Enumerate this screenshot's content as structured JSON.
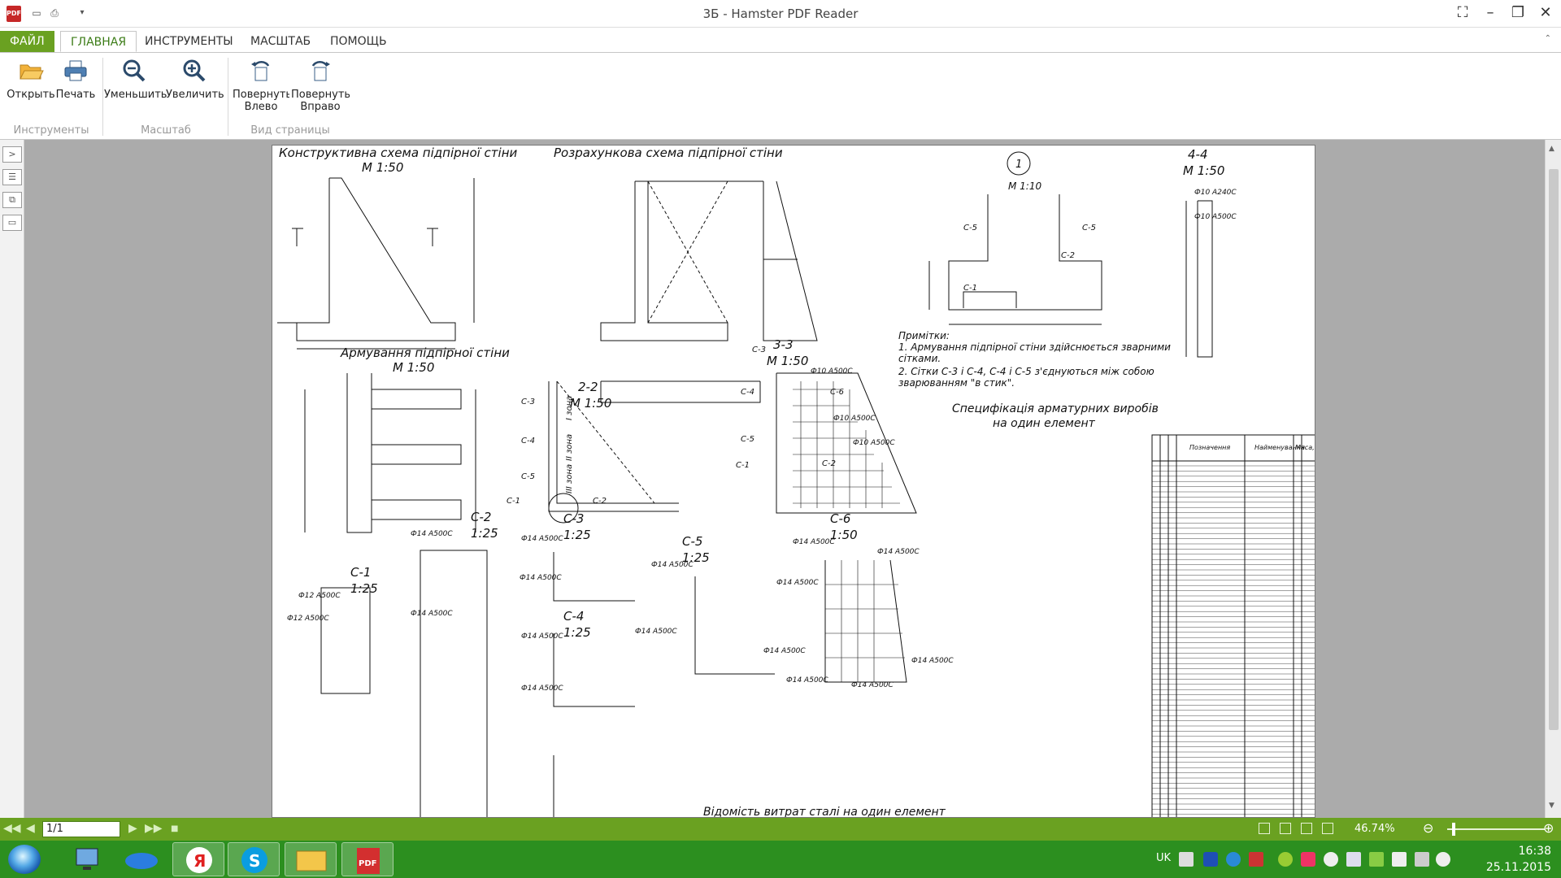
{
  "window": {
    "title": "3Б - Hamster PDF Reader",
    "app_icon_label": "PDF"
  },
  "quick_access": {
    "open_icon": "folder-open-icon",
    "print_icon": "printer-icon",
    "customize_icon": "dropdown-icon"
  },
  "tabs": [
    {
      "label": "ФАЙЛ"
    },
    {
      "label": "ГЛАВНАЯ"
    },
    {
      "label": "ИНСТРУМЕНТЫ"
    },
    {
      "label": "МАСШТАБ"
    },
    {
      "label": "ПОМОЩЬ"
    }
  ],
  "ribbon": {
    "open": "Открыть",
    "print": "Печать",
    "zoom_out": "Уменьшить",
    "zoom_in": "Увеличить",
    "rotate_left": "Повернуть Влево",
    "rotate_right": "Повернуть Вправо",
    "group_tools": "Инструменты",
    "group_scale": "Масштаб",
    "group_page_view": "Вид страницы"
  },
  "status": {
    "page": "1/1",
    "zoom": "46.74%"
  },
  "drawing": {
    "title_construct": "Конструктивна схема підпірної стіни",
    "title_calc": "Розрахункова схема підпірної стіни",
    "title_reinf": "Армування підпірної стіни",
    "scale_150": "М 1:50",
    "scale_110": "М 1:10",
    "circle_1": "1",
    "sec_44": "4-4",
    "sec_33": "3-3",
    "sec_22": "2-2",
    "c2": "С-2",
    "c3": "С-3",
    "c4": "С-4",
    "c5": "С-5",
    "c6": "С-6",
    "c1": "С-1",
    "scale_125": "1:25",
    "scale_150b": "1:50",
    "notes_title": "Примітки:",
    "note1": "1. Армування підпірної стіни здійснюється зварними",
    "note1b": "сітками.",
    "note2": "2. Сітки С-3 і С-4, С-4 і С-5 з'єднуються між собою",
    "note2b": "зварюванням \"в стик\".",
    "spec_title1": "Специфікація арматурних виробів",
    "spec_title2": "на один елемент",
    "spec_h_pos": "Позначення",
    "spec_h_name": "Найменування",
    "spec_h_mass": "Маса, кг",
    "bottom_title": "Відомість витрат сталі на один елемент",
    "lbl_d10_a240": "Ф10 А240С",
    "lbl_d10_a500": "Ф10 А500С",
    "lbl_d14_a500": "Ф14 А500С",
    "lbl_d12_a500": "Ф12 А500С",
    "zone1": "І зона",
    "zone2": "ІІ зона",
    "zone3": "ІІІ зона"
  },
  "tray": {
    "lang": "UK",
    "time": "16:38",
    "date": "25.11.2015"
  }
}
